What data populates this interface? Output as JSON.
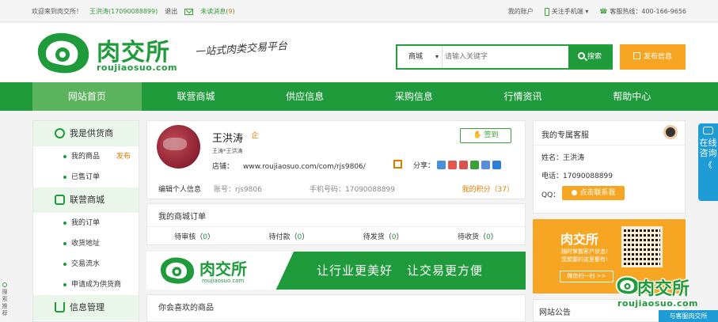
{
  "topbar": {
    "welcome": "欢迎来到肉交所！",
    "user": "王洪涛(17090088899)",
    "logout": "退出",
    "unread_label": "未读消息(",
    "unread_count": "9",
    "unread_close": ")",
    "my_account": "我的账户",
    "mobile": "关注手机端",
    "mobile_arrow": "▾",
    "hotline": "客服热线：400-166-9656"
  },
  "header": {
    "logo_name": "肉交所",
    "logo_domain": "roujiaosuo.com",
    "slogan": "一站式肉类交易平台",
    "search_category": "商城",
    "search_placeholder": "请输入关键字",
    "search_button": "搜索",
    "publish_button": "发布信息"
  },
  "nav": {
    "items": [
      "网站首页",
      "联营商城",
      "供应信息",
      "采购信息",
      "行情资讯",
      "帮助中心"
    ]
  },
  "sidebar": {
    "supplier_title": "我是供货商",
    "my_goods": "我的商品",
    "publish": "发布",
    "sold_orders": "已售订单",
    "mall_title": "联营商城",
    "mall_items": [
      "我的订单",
      "收货地址",
      "交易流水",
      "申请成为供货商"
    ],
    "info_title": "信息管理"
  },
  "profile": {
    "name": "王洪涛",
    "badge": "企",
    "sub": "王涛*王洪涛",
    "shop_label": "店铺：",
    "shop_url": "www.roujiaosuo.com/com/rjs9806/",
    "share_label": "分享：",
    "signin": "签到",
    "edit": "编辑个人信息",
    "account": "账号：rjs9806",
    "phone": "手机号码：17090088899",
    "points": "我的积分（37）"
  },
  "orders": {
    "title": "我的商城订单",
    "stats": [
      {
        "label": "待审核（",
        "value": "0",
        "close": "）"
      },
      {
        "label": "待付款（",
        "value": "0",
        "close": "）"
      },
      {
        "label": "待发货（",
        "value": "0",
        "close": "）"
      },
      {
        "label": "待收货（",
        "value": "0",
        "close": "）"
      }
    ]
  },
  "banner": {
    "name": "肉交所",
    "domain": "roujiaosuo.com",
    "slogan1": "让行业更美好",
    "slogan2": "让交易更方便"
  },
  "liked": {
    "title": "你会喜欢的商品"
  },
  "service": {
    "title": "我的专属客服",
    "name": "姓名：王洪涛",
    "phone": "电话：17090088899",
    "qq_label": "QQ：",
    "qq_button": "点击联系我"
  },
  "promo": {
    "brand": "肉交所",
    "line1": "随时掌握客户状态!",
    "line2": "您想要的这里都有!",
    "cta": "微信扫一扫 >>"
  },
  "notice": {
    "title": "网站公告"
  },
  "float_service": {
    "text1": "在线",
    "text2": "咨询",
    "chev": "《"
  },
  "side_left": {
    "text": "搜索推荐"
  },
  "watermark": {
    "name": "肉交所",
    "domain": "roujiaosuo.com"
  },
  "feedback": {
    "label": "与客服肉交所"
  },
  "colors": {
    "brand_green": "#1f9b3b",
    "accent_orange": "#f6a623",
    "blue": "#1f9bd6"
  }
}
